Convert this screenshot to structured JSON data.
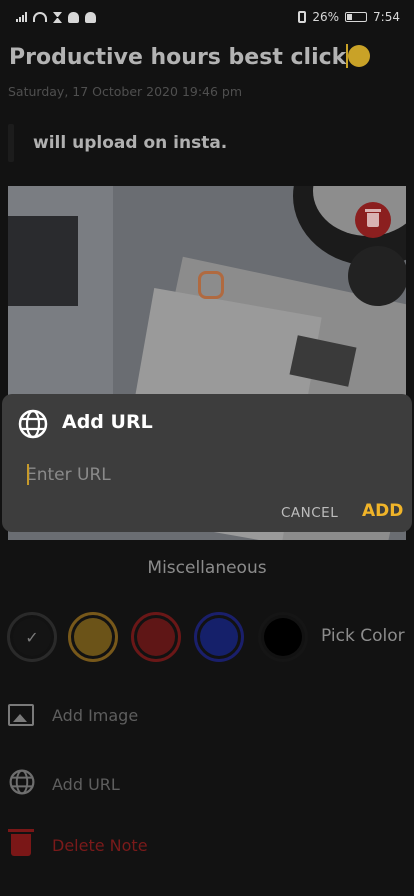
{
  "status_bar": {
    "battery": "26%",
    "time": "7:54",
    "battery_level": 0.26
  },
  "note": {
    "title": "Productive hours best click",
    "date": "Saturday, 17 October 2020 19:46 pm",
    "subtitle": "will upload on insta."
  },
  "dialog": {
    "title": "Add URL",
    "input_placeholder": "Enter URL",
    "cancel_label": "CANCEL",
    "add_label": "ADD"
  },
  "misc": {
    "title": "Miscellaneous",
    "pick_color_label": "Pick Color",
    "selected_check": "✓",
    "add_image_label": "Add Image",
    "add_url_label": "Add URL",
    "delete_note_label": "Delete Note",
    "colors": [
      "#333333",
      "#FDBE3B",
      "#FF4842",
      "#3A52FC",
      "#000000"
    ]
  }
}
